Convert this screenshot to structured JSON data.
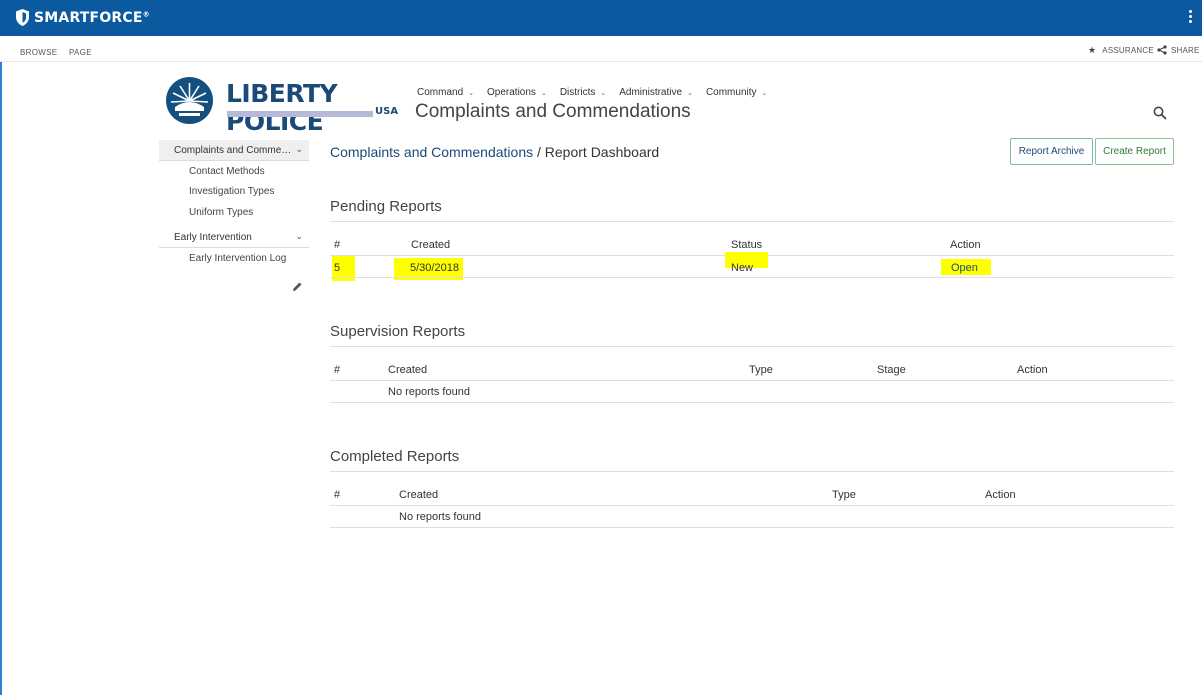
{
  "suite": {
    "brand": "SMARTFORCE",
    "trademark": "®"
  },
  "ribbon": {
    "tabs": [
      "BROWSE",
      "PAGE"
    ],
    "assurance": "ASSURANCE",
    "share": "SHARE"
  },
  "logo": {
    "title": "LIBERTY POLICE",
    "sub": "USA"
  },
  "topnav": {
    "items": [
      {
        "label": "Command"
      },
      {
        "label": "Operations"
      },
      {
        "label": "Districts"
      },
      {
        "label": "Administrative"
      },
      {
        "label": "Community"
      }
    ]
  },
  "site_title": "Complaints and Commendations",
  "quicklaunch": {
    "groups": [
      {
        "label": "Complaints and Comme…",
        "items": [
          "Contact Methods",
          "Investigation Types",
          "Uniform Types"
        ]
      },
      {
        "label": "Early Intervention",
        "items": [
          "Early Intervention Log"
        ]
      }
    ]
  },
  "breadcrumb": {
    "link": "Complaints and Commendations",
    "separator": " / ",
    "current": "Report Dashboard"
  },
  "buttons": {
    "archive": "Report Archive",
    "create": "Create Report"
  },
  "pending": {
    "title": "Pending Reports",
    "headers": [
      "#",
      "Created",
      "Status",
      "Action"
    ],
    "rows": [
      {
        "num": "5",
        "created": "5/30/2018",
        "status": "New",
        "action": "Open"
      }
    ]
  },
  "supervision": {
    "title": "Supervision Reports",
    "headers": [
      "#",
      "Created",
      "Type",
      "Stage",
      "Action"
    ],
    "empty": "No reports found"
  },
  "completed": {
    "title": "Completed Reports",
    "headers": [
      "#",
      "Created",
      "Type",
      "Action"
    ],
    "empty": "No reports found"
  },
  "colors": {
    "suitebar": "#0b5aa0",
    "brand_blue": "#1a4a78",
    "highlight": "#ffff00"
  }
}
